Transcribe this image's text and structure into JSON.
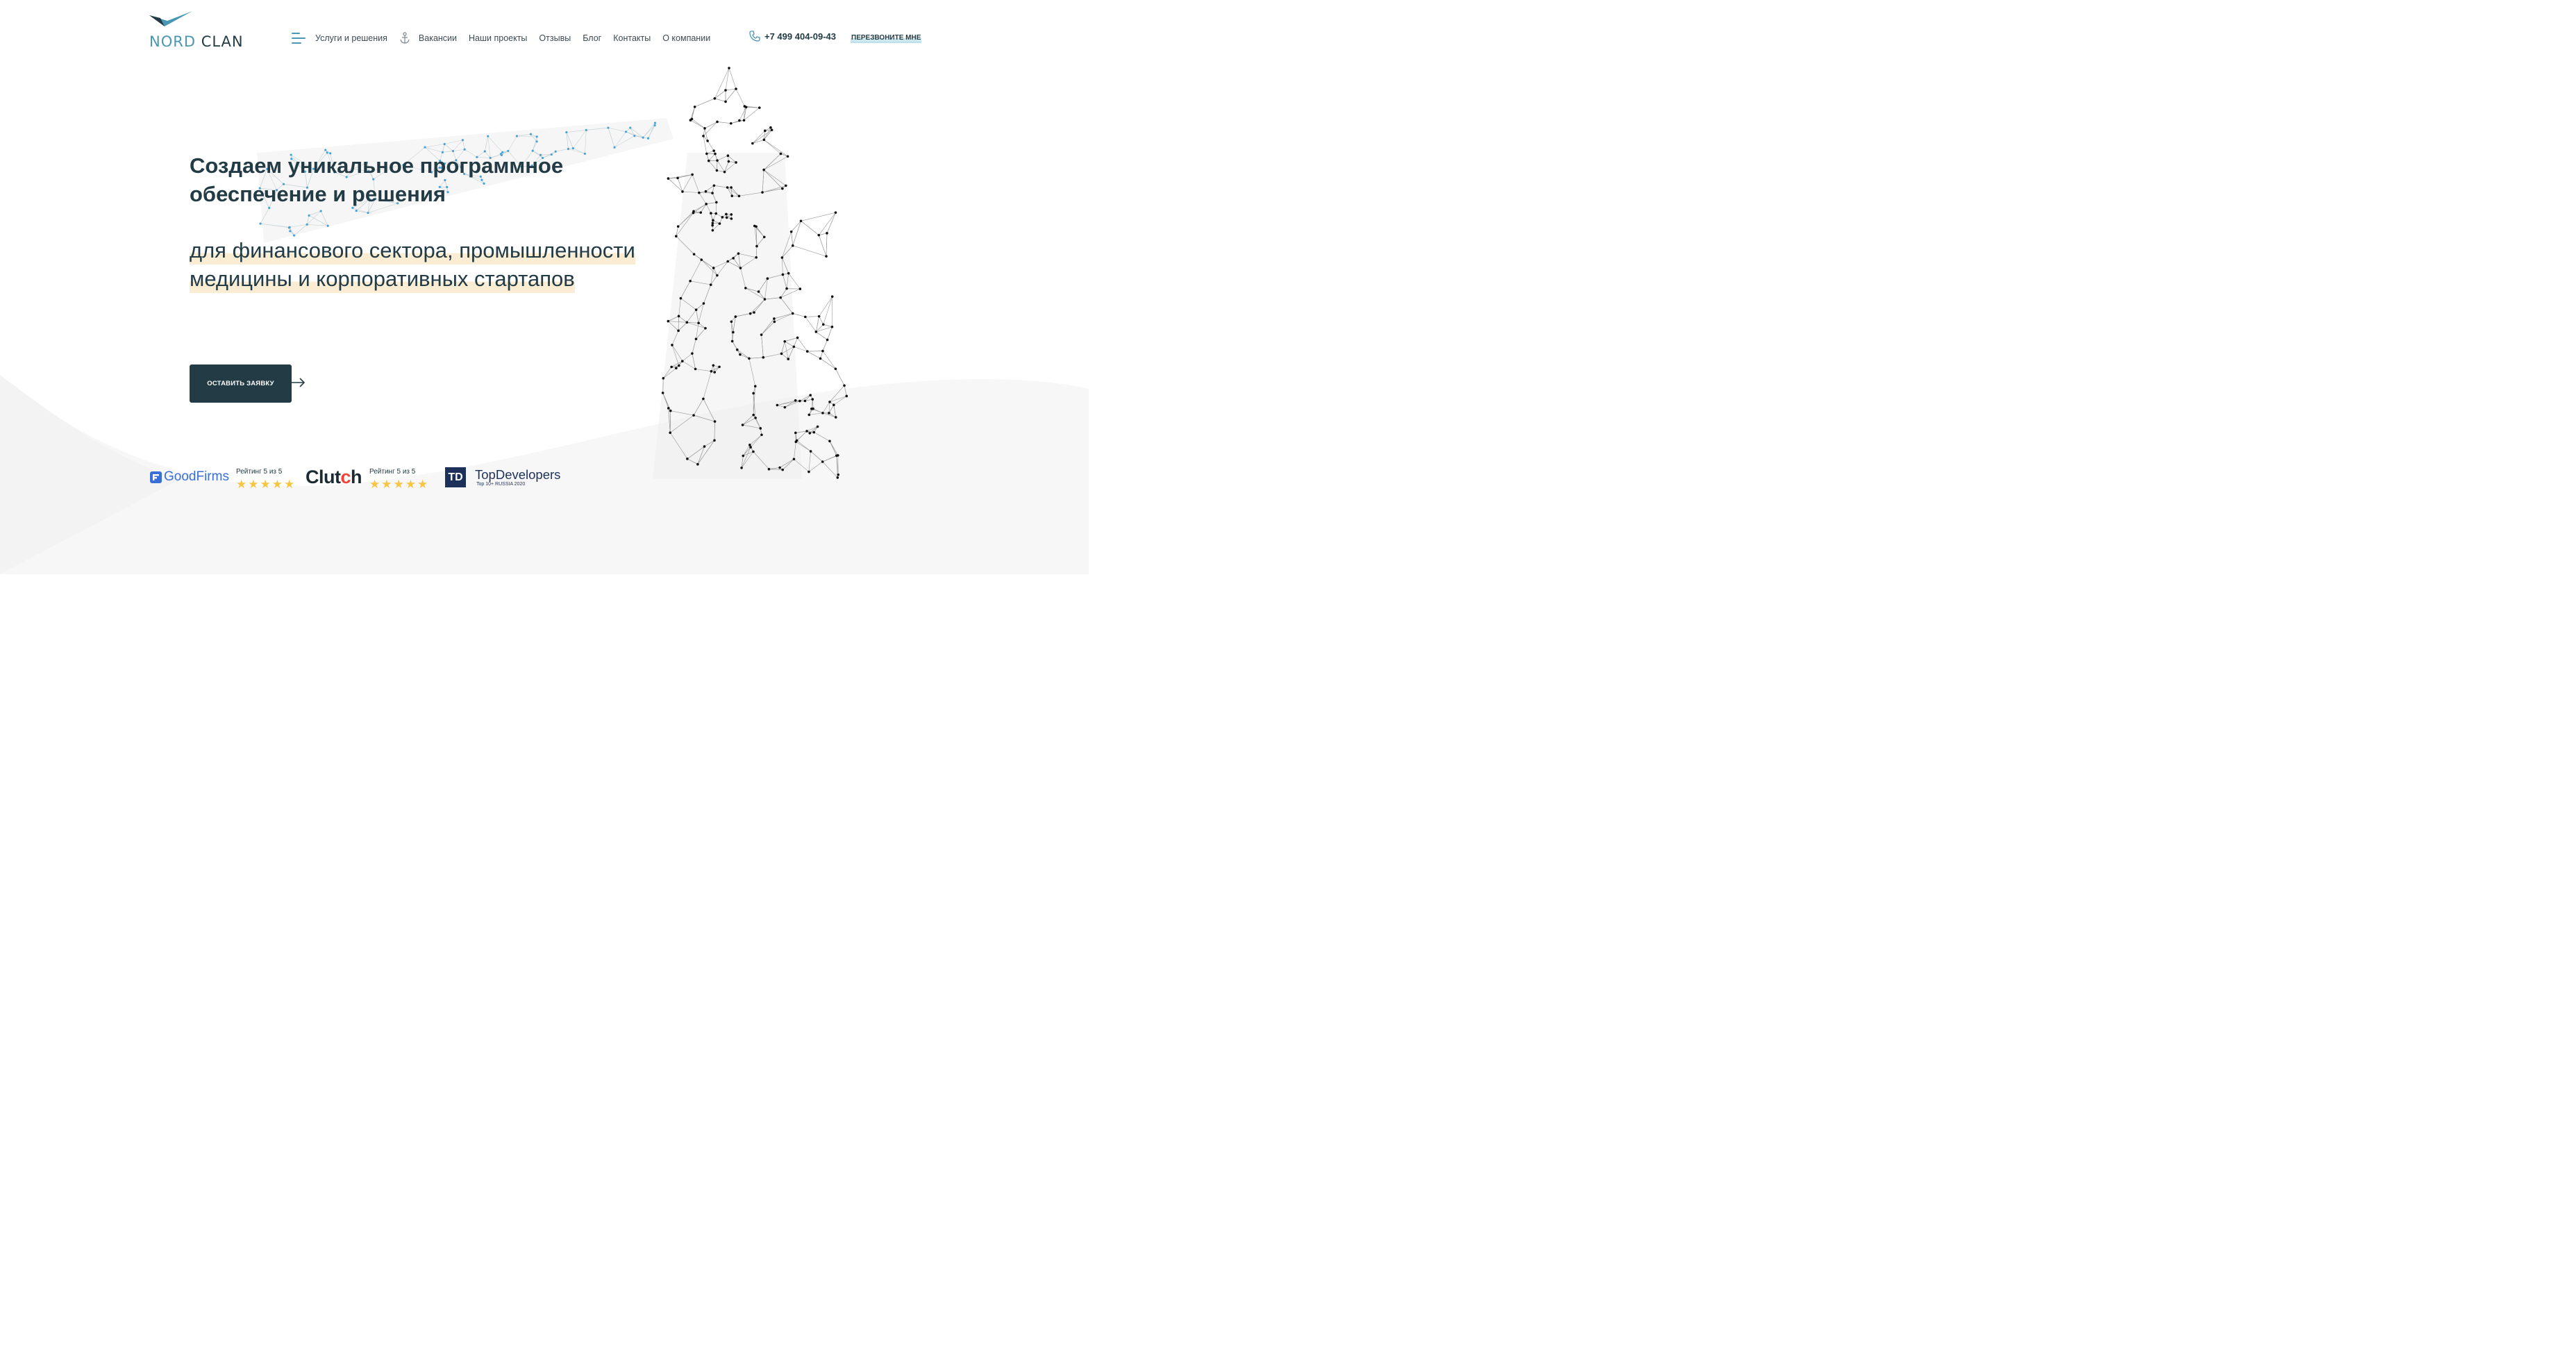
{
  "brand": {
    "name_part1": "NORD",
    "name_part2": "CLAN",
    "accent_color": "#4a97b4",
    "dark_color": "#233b44"
  },
  "nav": {
    "menu_icon": "hamburger-menu-icon",
    "items": [
      {
        "label": "Услуги и решения"
      },
      {
        "label": "Вакансии",
        "icon": "anchor-icon"
      },
      {
        "label": "Наши проекты"
      },
      {
        "label": "Отзывы"
      },
      {
        "label": "Блог"
      },
      {
        "label": "Контакты"
      },
      {
        "label": "О компании"
      }
    ]
  },
  "contact": {
    "phone_icon": "phone-icon",
    "phone": "+7 499 404-09-43",
    "callback_label": "ПЕРЕЗВОНИТЕ МНЕ"
  },
  "hero": {
    "title": "Создаем уникальное программное обеспечение и решения",
    "subtitle_line1": "для финансового сектора, промышленности",
    "subtitle_line2": "медицины и корпоративных стартапов",
    "cta_label": "ОСТАВИТЬ ЗАЯВКУ",
    "highlight_color": "#fbecd4"
  },
  "ratings": {
    "goodfirms": {
      "logo_text": "GoodFirms",
      "label": "Рейтинг 5 из 5",
      "stars": 5
    },
    "clutch": {
      "logo_text_a": "Clut",
      "logo_text_b": "c",
      "logo_text_c": "h",
      "label": "Рейтинг 5 из 5",
      "stars": 5
    },
    "topdevelopers": {
      "badge": "TD",
      "name": "TopDevelopers",
      "sub": "Top 10+  RUSSIA 2020"
    },
    "star_color": "#f6c543"
  }
}
